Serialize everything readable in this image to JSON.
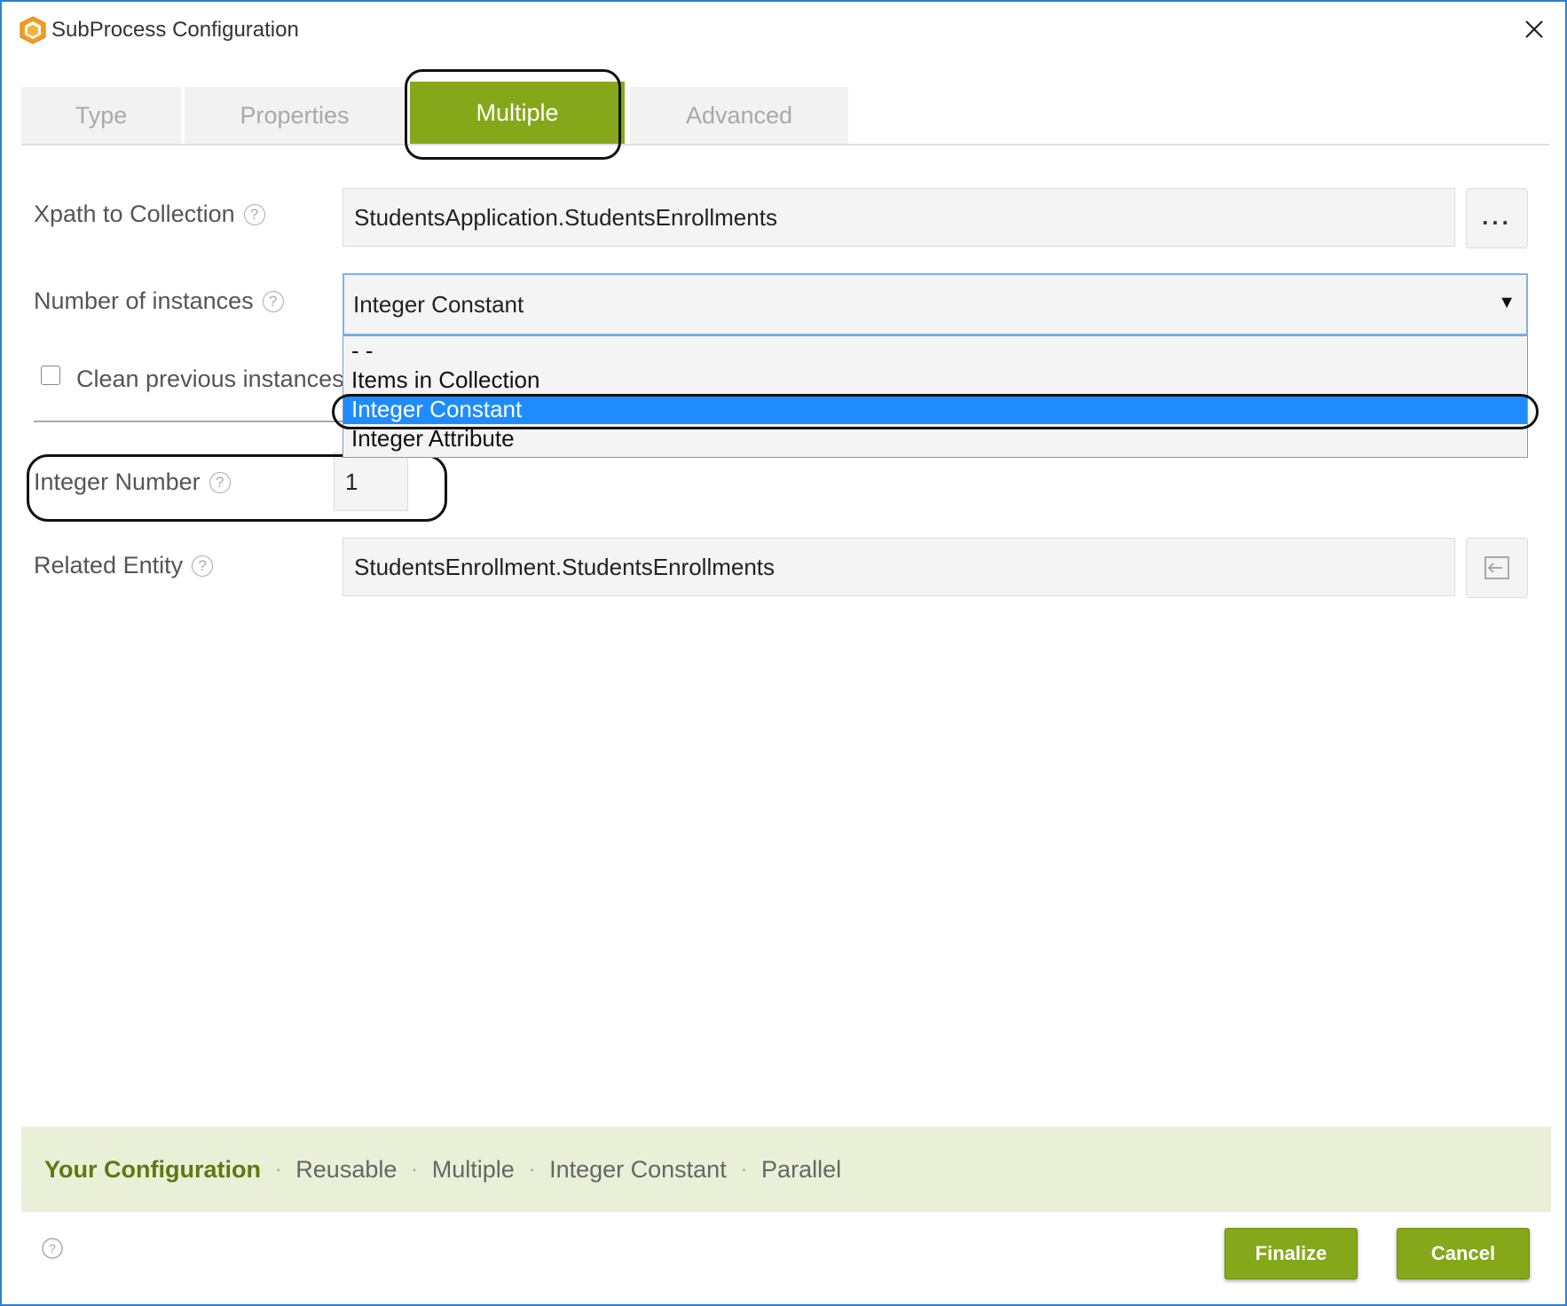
{
  "window": {
    "title": "SubProcess Configuration"
  },
  "tabs": [
    {
      "label": "Type"
    },
    {
      "label": "Properties"
    },
    {
      "label": "Multiple"
    },
    {
      "label": "Advanced"
    }
  ],
  "form": {
    "xpath": {
      "label": "Xpath to Collection",
      "value": "StudentsApplication.StudentsEnrollments",
      "button_label": "..."
    },
    "instances": {
      "label": "Number of instances",
      "selected": "Integer Constant",
      "options": [
        "- -",
        "Items in Collection",
        "Integer Constant",
        "Integer Attribute"
      ]
    },
    "clean": {
      "label": "Clean previous instances"
    },
    "integer": {
      "label": "Integer Number",
      "value": "1"
    },
    "entity": {
      "label": "Related Entity",
      "value": "StudentsEnrollment.StudentsEnrollments"
    }
  },
  "summary": {
    "title": "Your Configuration",
    "items": [
      "Reusable",
      "Multiple",
      "Integer Constant",
      "Parallel"
    ]
  },
  "buttons": {
    "finalize": "Finalize",
    "cancel": "Cancel"
  },
  "colors": {
    "accent": "#85a81a",
    "selection": "#1e8cff",
    "window_border": "#2b7fd6"
  }
}
